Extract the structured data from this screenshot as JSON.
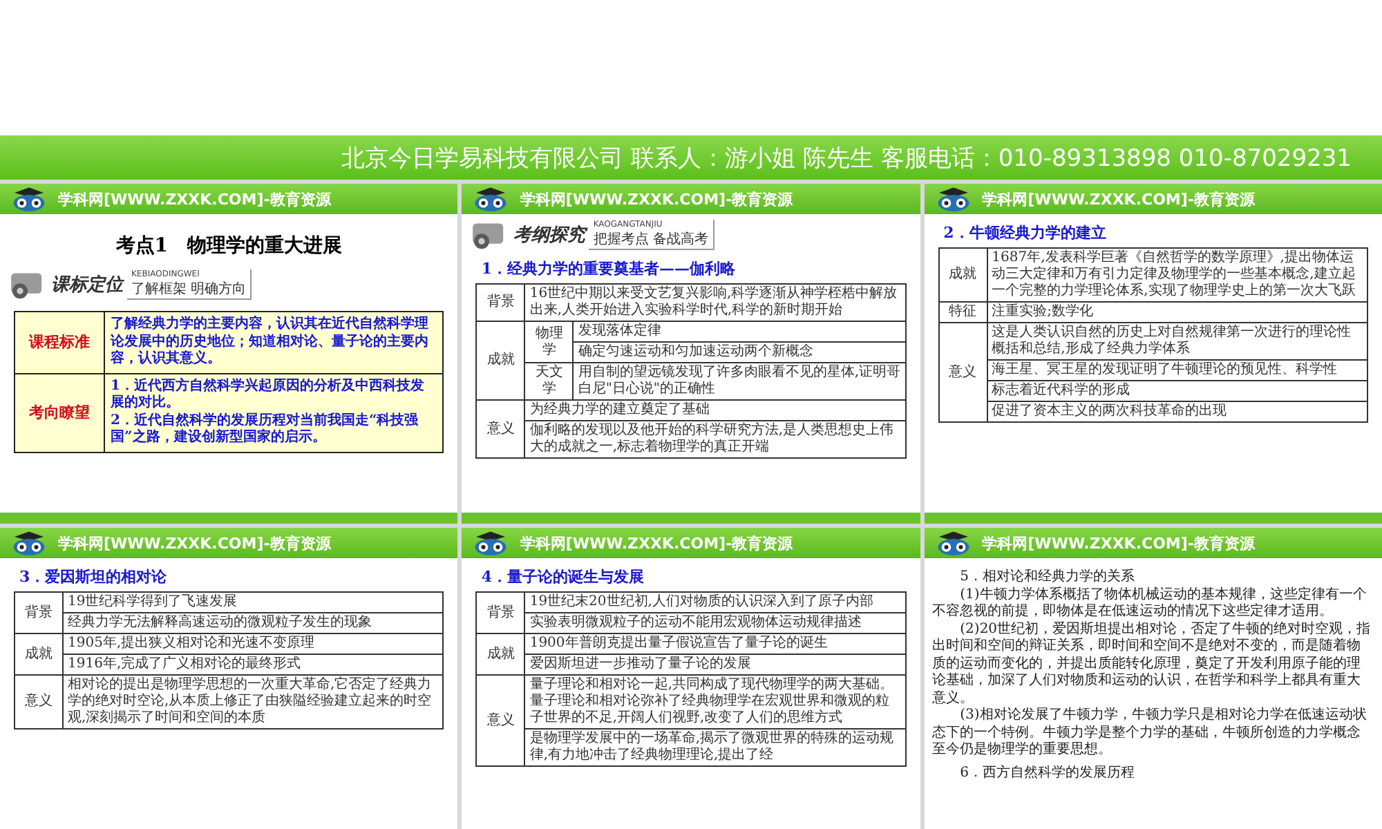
{
  "banner": {
    "text": "北京今日学易科技有限公司 联系人：游小姐 陈先生 客服电话：010-89313898 010-87029231"
  },
  "slides": [
    {
      "kind": "intro",
      "header": "学科网[WWW.ZXXK.COM]-教育资源",
      "title": "考点1　物理学的重大进展",
      "badge": {
        "title": "课标定位",
        "pinyin": "KEBIAODINGWEI",
        "motto": "了解框架 明确方向"
      },
      "standards": [
        {
          "label": "课程标准",
          "lines": [
            "了解经典力学的主要内容，认识其在近代自然科学理论发展中的历史地位；知道相对论、量子论的主要内容，认识其意义。"
          ]
        },
        {
          "label": "考向瞭望",
          "lines": [
            "1．近代西方自然科学兴起原因的分析及中西科技发展的对比。",
            "2．近代自然科学的发展历程对当前我国走“科技强国”之路，建设创新型国家的启示。"
          ]
        }
      ],
      "footer": true
    },
    {
      "kind": "table",
      "header": "学科网[WWW.ZXXK.COM]-教育资源",
      "badge": {
        "title": "考纲探究",
        "pinyin": "KAOGANGTANJIU",
        "motto": "把握考点 备战高考"
      },
      "heading": "1．经典力学的重要奠基者——伽利略",
      "table": {
        "groups": [
          {
            "label": "背景",
            "cells": [
              "16世纪中期以来受文艺复兴影响,科学逐渐从神学桎梏中解放出来,人类开始进入实验科学时代,科学的新时期开始"
            ]
          },
          {
            "label": "成就",
            "sub": [
              {
                "label": "物理学",
                "cells": [
                  "发现落体定律",
                  "确定匀速运动和匀加速运动两个新概念"
                ]
              },
              {
                "label": "天文学",
                "cells": [
                  "用自制的望远镜发现了许多肉眼看不见的星体,证明哥白尼\"日心说\"的正确性"
                ]
              }
            ]
          },
          {
            "label": "意义",
            "cells": [
              "为经典力学的建立奠定了基础",
              "伽利略的发现以及他开始的科学研究方法,是人类思想史上伟大的成就之一,标志着物理学的真正开端"
            ]
          }
        ]
      },
      "footer": true
    },
    {
      "kind": "table",
      "header": "学科网[WWW.ZXXK.COM]-教育资源",
      "heading": "2．牛顿经典力学的建立",
      "table": {
        "groups": [
          {
            "label": "成就",
            "cells": [
              "1687年,发表科学巨著《自然哲学的数学原理》,提出物体运动三大定律和万有引力定律及物理学的一些基本概念,建立起一个完整的力学理论体系,实现了物理学史上的第一次大飞跃"
            ]
          },
          {
            "label": "特征",
            "cells": [
              "注重实验;数学化"
            ]
          },
          {
            "label": "意义",
            "cells": [
              "这是人类认识自然的历史上对自然规律第一次进行的理论性概括和总结,形成了经典力学体系",
              "海王星、冥王星的发现证明了牛顿理论的预见性、科学性",
              "标志着近代科学的形成",
              "促进了资本主义的两次科技革命的出现"
            ]
          }
        ]
      },
      "footer": true
    },
    {
      "kind": "table",
      "header": "学科网[WWW.ZXXK.COM]-教育资源",
      "heading": "3．爱因斯坦的相对论",
      "table": {
        "groups": [
          {
            "label": "背景",
            "cells": [
              "19世纪科学得到了飞速发展",
              "经典力学无法解释高速运动的微观粒子发生的现象"
            ]
          },
          {
            "label": "成就",
            "cells": [
              "1905年,提出狭义相对论和光速不变原理",
              "1916年,完成了广义相对论的最终形式"
            ]
          },
          {
            "label": "意义",
            "cells": [
              "相对论的提出是物理学思想的一次重大革命,它否定了经典力学的绝对时空论,从本质上修正了由狭隘经验建立起来的时空观,深刻揭示了时间和空间的本质"
            ]
          }
        ]
      },
      "footer": false
    },
    {
      "kind": "table",
      "header": "学科网[WWW.ZXXK.COM]-教育资源",
      "heading": "4．量子论的诞生与发展",
      "table": {
        "groups": [
          {
            "label": "背景",
            "cells": [
              "19世纪末20世纪初,人们对物质的认识深入到了原子内部",
              "实验表明微观粒子的运动不能用宏观物体运动规律描述"
            ]
          },
          {
            "label": "成就",
            "cells": [
              "1900年普朗克提出量子假说宣告了量子论的诞生",
              "爱因斯坦进一步推动了量子论的发展"
            ]
          },
          {
            "label": "意义",
            "cells": [
              "量子理论和相对论一起,共同构成了现代物理学的两大基础。量子理论和相对论弥补了经典物理学在宏观世界和微观的粒子世界的不足,开阔人们视野,改变了人们的思维方式",
              "是物理学发展中的一场革命,揭示了微观世界的特殊的运动规律,有力地冲击了经典物理理论,提出了经"
            ]
          }
        ]
      },
      "footer": false
    },
    {
      "kind": "text",
      "header": "学科网[WWW.ZXXK.COM]-教育资源",
      "paragraphs": [
        {
          "kind": "heading",
          "text": "5．相对论和经典力学的关系"
        },
        {
          "kind": "para",
          "text": "(1)牛顿力学体系概括了物体机械运动的基本规律，这些定律有一个不容忽视的前提，即物体是在低速运动的情况下这些定律才适用。"
        },
        {
          "kind": "para",
          "text": "(2)20世纪初，爱因斯坦提出相对论，否定了牛顿的绝对时空观，指出时间和空间的辩证关系，即时间和空间不是绝对不变的，而是随着物质的运动而变化的，并提出质能转化原理，奠定了开发利用原子能的理论基础，加深了人们对物质和运动的认识，在哲学和科学上都具有重大意义。"
        },
        {
          "kind": "para",
          "text": "(3)相对论发展了牛顿力学，牛顿力学只是相对论力学在低速运动状态下的一个特例。牛顿力学是整个力学的基础，牛顿所创造的力学概念至今仍是物理学的重要思想。"
        },
        {
          "kind": "heading",
          "text": "6．西方自然科学的发展历程"
        }
      ],
      "footer": false
    }
  ]
}
